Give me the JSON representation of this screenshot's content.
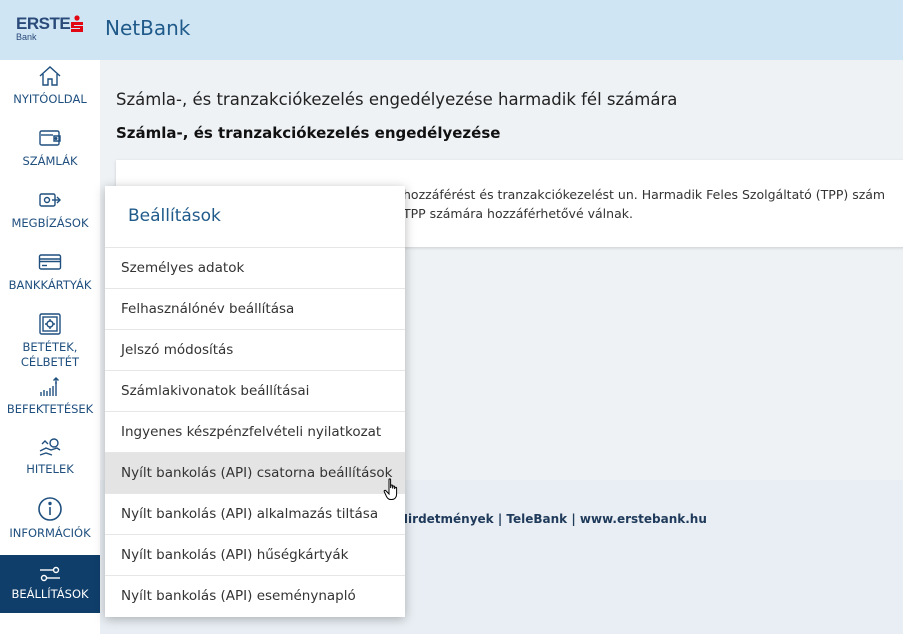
{
  "header": {
    "logo_text": "ERSTE",
    "logo_sub": "Bank",
    "app_title": "NetBank",
    "colors": {
      "topbar": "#cfe5f3",
      "brand_red": "#e30613",
      "brand_blue": "#1f5a8a"
    }
  },
  "sidebar": {
    "items": [
      {
        "label": "NYITÓOLDAL",
        "icon": "home-icon"
      },
      {
        "label": "SZÁMLÁK",
        "icon": "wallet-icon"
      },
      {
        "label": "MEGBÍZÁSOK",
        "icon": "transfer-icon"
      },
      {
        "label": "BANKKÁRTYÁK",
        "icon": "card-icon"
      },
      {
        "label": "BETÉTEK, CÉLBETÉT",
        "icon": "safe-icon"
      },
      {
        "label": "BEFEKTETÉSEK",
        "icon": "chart-icon"
      },
      {
        "label": "HITELEK",
        "icon": "loan-icon"
      },
      {
        "label": "INFORMÁCIÓK",
        "icon": "info-icon"
      },
      {
        "label": "BEÁLLÍTÁSOK",
        "icon": "settings-icon",
        "active": true
      }
    ]
  },
  "main": {
    "page_title": "Számla-, és tranzakciókezelés engedélyezése harmadik fél számára",
    "section_title": "Számla-, és tranzakciókezelés engedélyezése",
    "card_line1": "hozzáférést és tranzakciókezelést un. Harmadik Feles Szolgáltató (TPP) szám",
    "card_line2": "TPP számára hozzáférhetővé válnak.",
    "footer_links": "Hirdetmények | TeleBank | www.erstebank.hu"
  },
  "settings_menu": {
    "title": "Beállítások",
    "items": [
      "Személyes adatok",
      "Felhasználónév beállítása",
      "Jelszó módosítás",
      "Számlakivonatok beállításai",
      "Ingyenes készpénzfelvételi nyilatkozat",
      "Nyílt bankolás (API) csatorna beállítások",
      "Nyílt bankolás (API) alkalmazás tiltása",
      "Nyílt bankolás (API) hűségkártyák",
      "Nyílt bankolás (API) eseménynapló"
    ],
    "hovered_index": 5
  }
}
